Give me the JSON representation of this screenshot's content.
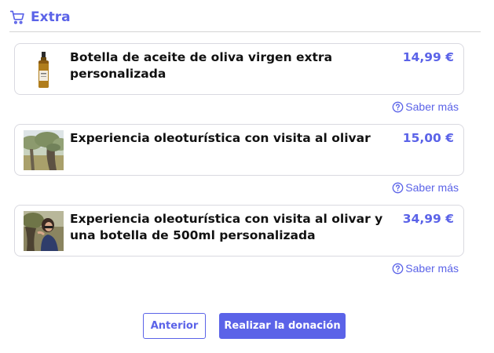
{
  "section": {
    "title": "Extra",
    "icon": "cart-icon",
    "accent_color": "#5b63e8"
  },
  "products": [
    {
      "name": "Botella de aceite de oliva virgen extra personalizada",
      "price": "14,99 €",
      "image": "olive-oil-bottle-image",
      "more_label": "Saber más"
    },
    {
      "name": "Experiencia oleoturística con visita al olivar",
      "price": "15,00 €",
      "image": "olive-grove-image",
      "more_label": "Saber más"
    },
    {
      "name": "Experiencia oleoturística con visita al olivar y una botella de 500ml personalizada",
      "price": "34,99 €",
      "image": "visitor-olive-tree-image",
      "more_label": "Saber más"
    }
  ],
  "buttons": {
    "previous_label": "Anterior",
    "donate_label": "Realizar la donación"
  }
}
